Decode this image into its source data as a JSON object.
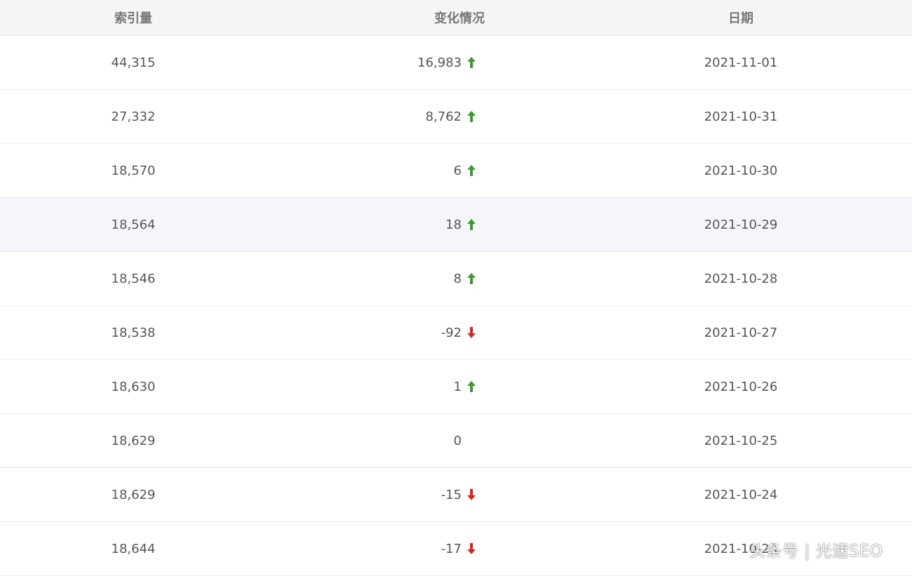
{
  "table": {
    "headers": {
      "index": "索引量",
      "change": "变化情况",
      "date": "日期"
    },
    "rows": [
      {
        "index": "44,315",
        "change": "16,983",
        "trend": "up",
        "date": "2021-11-01"
      },
      {
        "index": "27,332",
        "change": "8,762",
        "trend": "up",
        "date": "2021-10-31"
      },
      {
        "index": "18,570",
        "change": "6",
        "trend": "up",
        "date": "2021-10-30"
      },
      {
        "index": "18,564",
        "change": "18",
        "trend": "up",
        "date": "2021-10-29"
      },
      {
        "index": "18,546",
        "change": "8",
        "trend": "up",
        "date": "2021-10-28"
      },
      {
        "index": "18,538",
        "change": "-92",
        "trend": "down",
        "date": "2021-10-27"
      },
      {
        "index": "18,630",
        "change": "1",
        "trend": "up",
        "date": "2021-10-26"
      },
      {
        "index": "18,629",
        "change": "0",
        "trend": "none",
        "date": "2021-10-25"
      },
      {
        "index": "18,629",
        "change": "-15",
        "trend": "down",
        "date": "2021-10-24"
      },
      {
        "index": "18,644",
        "change": "-17",
        "trend": "down",
        "date": "2021-10-23"
      }
    ]
  },
  "colors": {
    "up": "#3a9a2e",
    "down": "#d9261c",
    "hover_row": "#f4f6fb"
  },
  "watermark": {
    "source": "头条号",
    "separator": "|",
    "author": "光速SEO"
  }
}
